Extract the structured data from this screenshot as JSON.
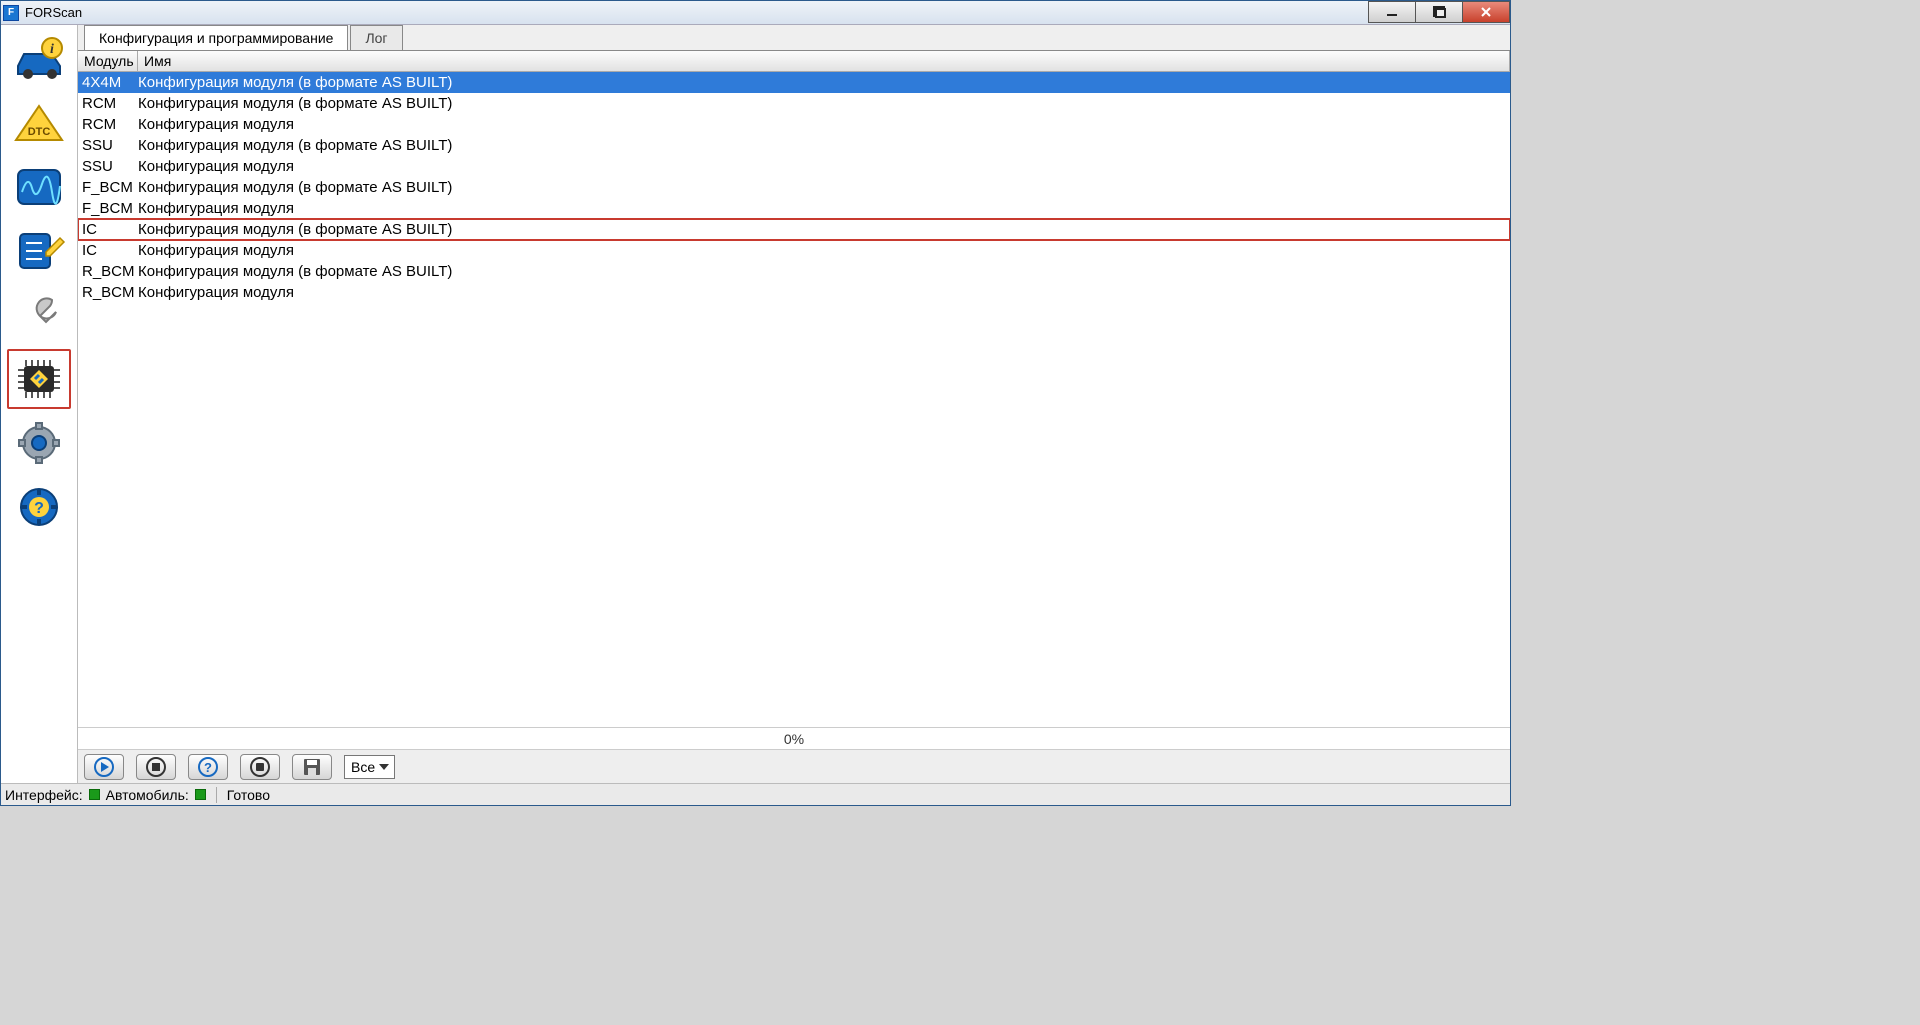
{
  "app": {
    "title": "FORScan",
    "icon_letter": "F"
  },
  "tabs": {
    "active": "Конфигурация и программирование",
    "inactive": "Лог"
  },
  "columns": {
    "module": "Модуль",
    "name": "Имя"
  },
  "rows": [
    {
      "module": "4X4M",
      "name": "Конфигурация модуля (в формате AS BUILT)",
      "selected": true,
      "boxmark": false
    },
    {
      "module": "RCM",
      "name": "Конфигурация модуля (в формате AS BUILT)",
      "selected": false,
      "boxmark": false
    },
    {
      "module": "RCM",
      "name": "Конфигурация модуля",
      "selected": false,
      "boxmark": false
    },
    {
      "module": "SSU",
      "name": "Конфигурация модуля (в формате AS BUILT)",
      "selected": false,
      "boxmark": false
    },
    {
      "module": "SSU",
      "name": "Конфигурация модуля",
      "selected": false,
      "boxmark": false
    },
    {
      "module": "F_BCM",
      "name": "Конфигурация модуля (в формате AS BUILT)",
      "selected": false,
      "boxmark": false
    },
    {
      "module": "F_BCM",
      "name": "Конфигурация модуля",
      "selected": false,
      "boxmark": false
    },
    {
      "module": "IC",
      "name": "Конфигурация модуля (в формате AS BUILT)",
      "selected": false,
      "boxmark": true
    },
    {
      "module": "IC",
      "name": "Конфигурация модуля",
      "selected": false,
      "boxmark": false
    },
    {
      "module": "R_BCM",
      "name": "Конфигурация модуля (в формате AS BUILT)",
      "selected": false,
      "boxmark": false
    },
    {
      "module": "R_BCM",
      "name": "Конфигурация модуля",
      "selected": false,
      "boxmark": false
    }
  ],
  "progress": {
    "text": "0%"
  },
  "filter_select": {
    "value": "Все"
  },
  "status": {
    "interface_label": "Интерфейс:",
    "car_label": "Автомобиль:",
    "ready_label": "Готово"
  }
}
